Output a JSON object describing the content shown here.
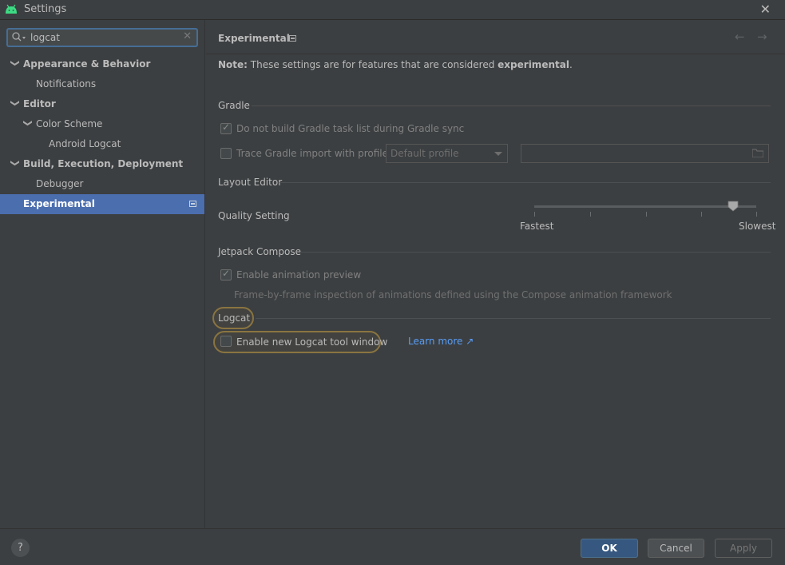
{
  "window": {
    "title": "Settings"
  },
  "search": {
    "value": "logcat"
  },
  "tree": [
    {
      "label": "Appearance & Behavior",
      "bold": true,
      "expanded": true,
      "indent": 0
    },
    {
      "label": "Notifications",
      "bold": false,
      "indent": 1
    },
    {
      "label": "Editor",
      "bold": true,
      "expanded": true,
      "indent": 0
    },
    {
      "label": "Color Scheme",
      "bold": false,
      "expanded": true,
      "indent": 1
    },
    {
      "label": "Android Logcat",
      "bold": false,
      "indent": 2
    },
    {
      "label": "Build, Execution, Deployment",
      "bold": true,
      "expanded": true,
      "indent": 0
    },
    {
      "label": "Debugger",
      "bold": false,
      "indent": 1
    },
    {
      "label": "Experimental",
      "bold": true,
      "selected": true,
      "indent": 0
    }
  ],
  "page": {
    "title": "Experimental",
    "note_prefix": "Note:",
    "note_text": " These settings are for features that are considered ",
    "note_bold": "experimental",
    "note_suffix": "."
  },
  "gradle": {
    "section": "Gradle",
    "no_build_task_list": {
      "label": "Do not build Gradle task list during Gradle sync",
      "checked": true
    },
    "trace_import": {
      "label": "Trace Gradle import with profile:",
      "checked": false
    },
    "profile_dropdown": "Default profile"
  },
  "layout_editor": {
    "section": "Layout Editor",
    "quality_label": "Quality Setting",
    "fastest": "Fastest",
    "slowest": "Slowest",
    "quality_value": 0.9
  },
  "jetpack_compose": {
    "section": "Jetpack Compose",
    "animation_preview": {
      "label": "Enable animation preview",
      "checked": true
    },
    "hint": "Frame-by-frame inspection of animations defined using the Compose animation framework"
  },
  "logcat": {
    "section": "Logcat",
    "new_tool_window": {
      "label": "Enable new Logcat tool window",
      "checked": false
    },
    "learn_more": "Learn more ↗"
  },
  "buttons": {
    "help": "?",
    "ok": "OK",
    "cancel": "Cancel",
    "apply": "Apply"
  }
}
